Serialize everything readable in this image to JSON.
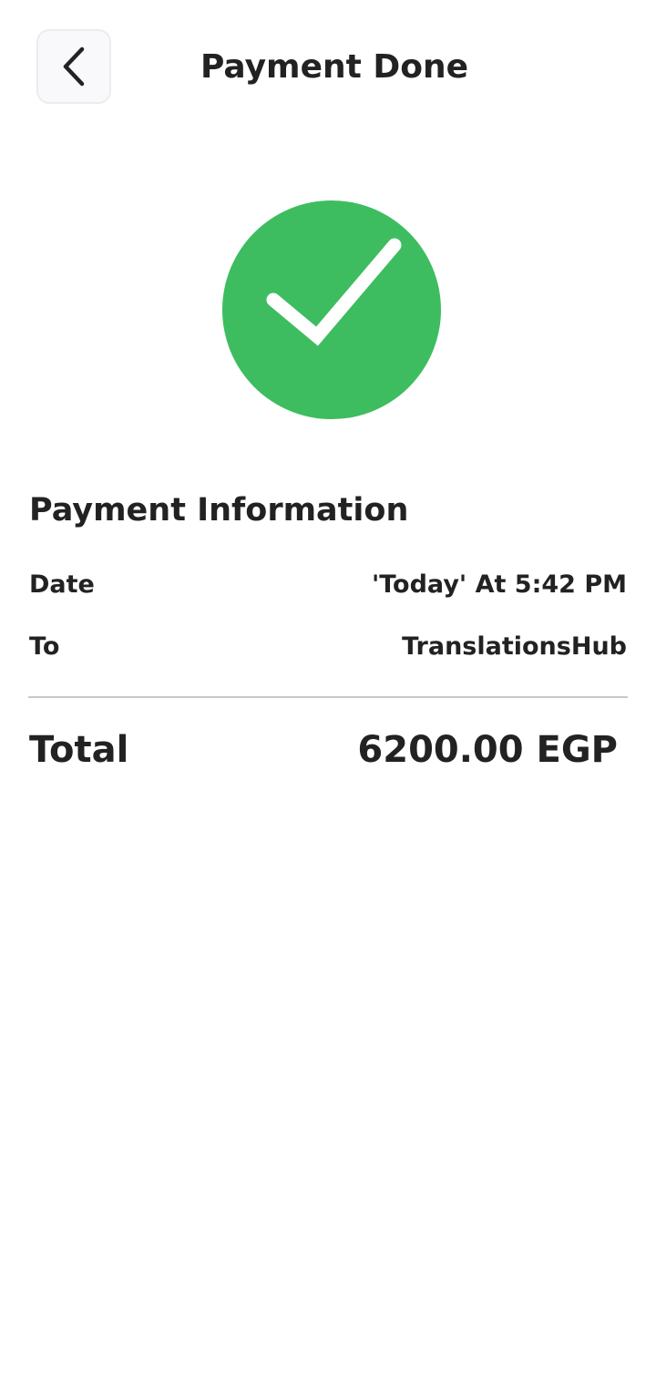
{
  "header": {
    "title": "Payment Done",
    "back_icon": "chevron-left-icon"
  },
  "status": {
    "icon": "check-circle-icon",
    "color": "#3dbd5f"
  },
  "payment_info": {
    "title": "Payment Information",
    "rows": [
      {
        "label": "Date",
        "value": "'Today' At 5:42 PM"
      },
      {
        "label": "To",
        "value": "TranslationsHub"
      }
    ],
    "total": {
      "label": "Total",
      "value": "6200.00 EGP"
    }
  }
}
